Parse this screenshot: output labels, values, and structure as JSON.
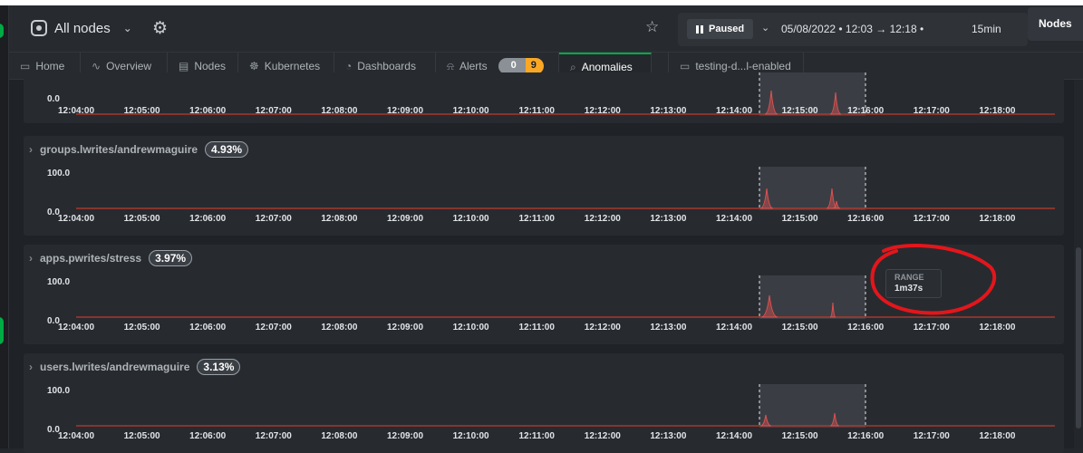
{
  "topbar": {
    "nodes_selector": "All nodes",
    "paused_label": "Paused",
    "time_range": "05/08/2022 • 12:03  →  12:18 •",
    "duration": "15min",
    "nodes_button": "Nodes"
  },
  "tabs": [
    {
      "label": "Home",
      "icon": "monitor-icon"
    },
    {
      "label": "Overview",
      "icon": "overview-icon"
    },
    {
      "label": "Nodes",
      "icon": "nodes-icon"
    },
    {
      "label": "Kubernetes",
      "icon": "kubernetes-icon"
    },
    {
      "label": "Dashboards",
      "icon": "dashboard-icon"
    },
    {
      "label": "Alerts",
      "icon": "bell-icon",
      "badge_warning": "0",
      "badge_critical": "9"
    },
    {
      "label": "Anomalies",
      "icon": "search-icon",
      "active": true
    },
    {
      "label": "testing-d...l-enabled",
      "icon": "window-icon"
    }
  ],
  "x_ticks": [
    "12:04:00",
    "12:05:00",
    "12:06:00",
    "12:07:00",
    "12:08:00",
    "12:09:00",
    "12:10:00",
    "12:11:00",
    "12:12:00",
    "12:13:00",
    "12:14:00",
    "12:15:00",
    "12:16:00",
    "12:17:00",
    "12:18:00"
  ],
  "panels": [
    {
      "title": "",
      "score": "",
      "ymax": "",
      "ymin": "0.0"
    },
    {
      "title": "groups.lwrites/andrewmaguire",
      "score": "4.93%",
      "ymax": "100.0",
      "ymin": "0.0"
    },
    {
      "title": "apps.pwrites/stress",
      "score": "3.97%",
      "ymax": "100.0",
      "ymin": "0.0"
    },
    {
      "title": "users.lwrites/andrewmaguire",
      "score": "3.13%",
      "ymax": "100.0",
      "ymin": "0.0"
    }
  ],
  "tooltip": {
    "label": "RANGE",
    "value": "1m37s"
  },
  "colors": {
    "accent": "#00ab44",
    "series": "#c0392b",
    "highlight": "#3a3e44",
    "annotation": "#e3161b",
    "warning": "#f9a825"
  }
}
